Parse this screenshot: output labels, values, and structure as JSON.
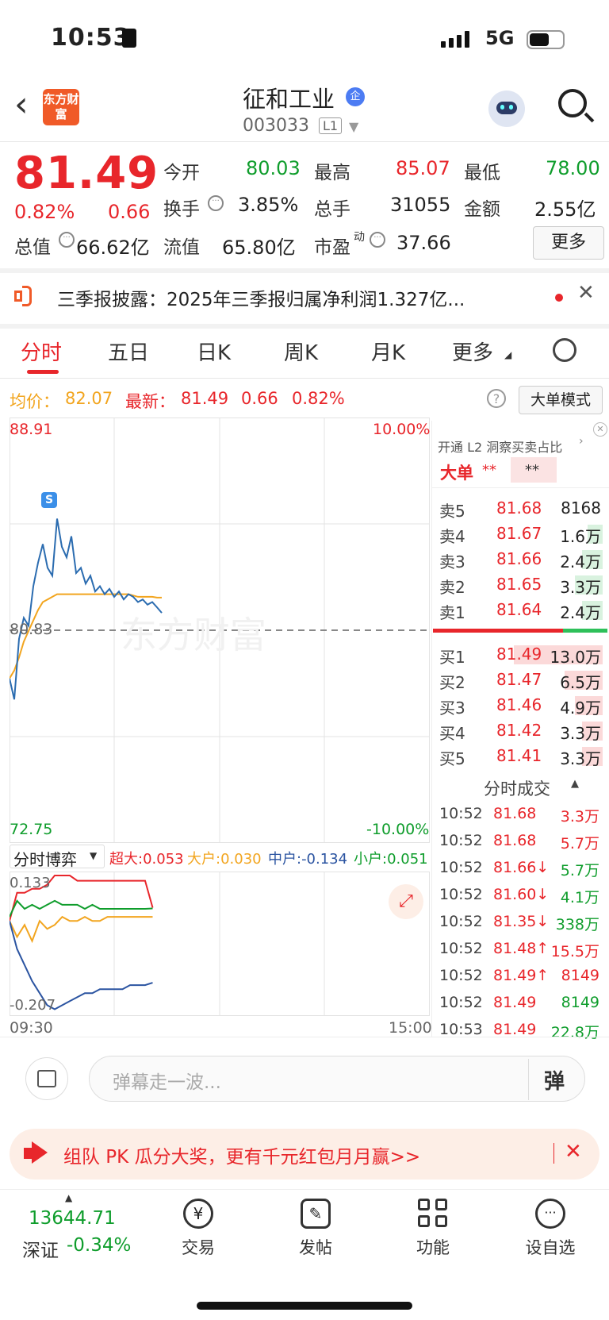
{
  "status_bar": {
    "time": "10:53",
    "network": "5G"
  },
  "header": {
    "logo_text": "东方财富",
    "stock_name": "征和工业",
    "badge": "企",
    "stock_code": "003033",
    "level": "L1"
  },
  "quote": {
    "price": "81.49",
    "change_pct": "0.82%",
    "change": "0.66",
    "open_label": "今开",
    "open": "80.03",
    "high_label": "最高",
    "high": "85.07",
    "low_label": "最低",
    "low": "78.00",
    "turnover_label": "换手",
    "turnover": "3.85%",
    "volume_label": "总手",
    "volume": "31055",
    "amount_label": "金额",
    "amount": "2.55亿",
    "mcap_label": "总值",
    "mcap": "66.62亿",
    "float_label": "流值",
    "float_mcap": "65.80亿",
    "pe_label": "市盈",
    "pe_sup": "动",
    "pe": "37.66",
    "more_label": "更多"
  },
  "announcement": {
    "text": "三季报披露：2025年三季报归属净利润1.327亿..."
  },
  "tabs": [
    "分时",
    "五日",
    "日K",
    "周K",
    "月K",
    "更多"
  ],
  "info_line": {
    "avg_label": "均价：",
    "avg": "82.07",
    "latest_label": "最新：",
    "latest": "81.49",
    "change": "0.66",
    "change_pct": "0.82%",
    "mode_btn": "大单模式"
  },
  "chart_data": {
    "type": "line",
    "y_max": "88.91",
    "y_min": "72.75",
    "y_ref": "80.83",
    "pct_max": "10.00%",
    "pct_min": "-10.00%",
    "marker": "S",
    "x_start": "09:30",
    "x_end": "15:00",
    "ylim": [
      72.75,
      88.91
    ],
    "price_series": [
      79.0,
      78.2,
      80.5,
      81.3,
      81.0,
      82.5,
      83.4,
      84.1,
      83.2,
      82.9,
      85.07,
      84.0,
      83.6,
      84.4,
      83.0,
      83.2,
      82.6,
      82.9,
      82.3,
      82.5,
      82.2,
      82.4,
      82.1,
      82.3,
      82.0,
      82.2,
      82.1,
      81.9,
      82.0,
      81.8,
      81.9,
      81.7,
      81.49
    ],
    "avg_series": [
      79.0,
      79.3,
      79.8,
      80.4,
      80.8,
      81.2,
      81.6,
      81.9,
      82.0,
      82.1,
      82.2,
      82.2,
      82.2,
      82.2,
      82.2,
      82.2,
      82.2,
      82.2,
      82.2,
      82.2,
      82.2,
      82.2,
      82.2,
      82.2,
      82.2,
      82.2,
      82.15,
      82.1,
      82.1,
      82.1,
      82.1,
      82.07,
      82.07
    ]
  },
  "sub_chart": {
    "selector": "分时博弈",
    "legend": [
      {
        "label": "超大:0.053",
        "color": "#e8262b"
      },
      {
        "label": "大户:0.030",
        "color": "#f2a51f"
      },
      {
        "label": "中户:-0.134",
        "color": "#2b54a1"
      },
      {
        "label": "小户:0.051",
        "color": "#0f9d2c"
      }
    ],
    "y_top": "0.133",
    "y_bottom": "-0.207",
    "ylim": [
      -0.207,
      0.133
    ],
    "series": {
      "super_large": [
        0.02,
        0.09,
        0.09,
        0.1,
        0.1,
        0.11,
        0.133,
        0.133,
        0.133,
        0.12,
        0.12,
        0.12,
        0.12,
        0.12,
        0.12,
        0.12,
        0.12,
        0.12,
        0.12,
        0.053
      ],
      "large": [
        0.02,
        -0.02,
        0.01,
        -0.03,
        0.02,
        0.0,
        0.01,
        0.03,
        0.02,
        0.02,
        0.03,
        0.02,
        0.02,
        0.03,
        0.03,
        0.03,
        0.03,
        0.03,
        0.03,
        0.03
      ],
      "medium": [
        0.02,
        -0.05,
        -0.09,
        -0.13,
        -0.16,
        -0.19,
        -0.2,
        -0.19,
        -0.18,
        -0.17,
        -0.16,
        -0.16,
        -0.15,
        -0.15,
        -0.15,
        -0.15,
        -0.14,
        -0.14,
        -0.14,
        -0.134
      ],
      "small": [
        0.03,
        0.07,
        0.05,
        0.06,
        0.05,
        0.06,
        0.07,
        0.06,
        0.06,
        0.06,
        0.05,
        0.06,
        0.05,
        0.05,
        0.05,
        0.05,
        0.05,
        0.05,
        0.05,
        0.051
      ]
    }
  },
  "right_panel": {
    "promo": "开通 L2 洞察买卖占比",
    "big_order_label": "大单",
    "masked1": "**",
    "masked2": "**",
    "asks": [
      {
        "label": "卖5",
        "price": "81.68",
        "vol": "8168"
      },
      {
        "label": "卖4",
        "price": "81.67",
        "vol": "1.6万"
      },
      {
        "label": "卖3",
        "price": "81.66",
        "vol": "2.4万"
      },
      {
        "label": "卖2",
        "price": "81.65",
        "vol": "3.3万"
      },
      {
        "label": "卖1",
        "price": "81.64",
        "vol": "2.4万"
      }
    ],
    "bids": [
      {
        "label": "买1",
        "price": "81.49",
        "vol": "13.0万"
      },
      {
        "label": "买2",
        "price": "81.47",
        "vol": "6.5万"
      },
      {
        "label": "买3",
        "price": "81.46",
        "vol": "4.9万"
      },
      {
        "label": "买4",
        "price": "81.42",
        "vol": "3.3万"
      },
      {
        "label": "买5",
        "price": "81.41",
        "vol": "3.3万"
      }
    ],
    "trades_title": "分时成交",
    "trades": [
      {
        "time": "10:52",
        "price": "81.68",
        "vol": "3.3万",
        "vol_color": "red"
      },
      {
        "time": "10:52",
        "price": "81.68",
        "vol": "5.7万",
        "vol_color": "red"
      },
      {
        "time": "10:52",
        "price": "81.66↓",
        "vol": "5.7万",
        "vol_color": "green"
      },
      {
        "time": "10:52",
        "price": "81.60↓",
        "vol": "4.1万",
        "vol_color": "green"
      },
      {
        "time": "10:52",
        "price": "81.35↓",
        "vol": "338万",
        "vol_color": "green"
      },
      {
        "time": "10:52",
        "price": "81.48↑",
        "vol": "15.5万",
        "vol_color": "red"
      },
      {
        "time": "10:52",
        "price": "81.49↑",
        "vol": "8149",
        "vol_color": "red"
      },
      {
        "time": "10:52",
        "price": "81.49",
        "vol": "8149",
        "vol_color": "green"
      },
      {
        "time": "10:53",
        "price": "81.49",
        "vol": "22.8万",
        "vol_color": "green"
      }
    ]
  },
  "chat": {
    "placeholder": "弹幕走一波...",
    "send_label": "弹"
  },
  "promo_banner": {
    "text": "组队 PK 瓜分大奖，更有千元红包月月赢>>"
  },
  "bottom_nav": {
    "index_value": "13644.71",
    "index_name": "深证",
    "index_change": "-0.34%",
    "items": [
      "交易",
      "发帖",
      "功能",
      "设自选"
    ]
  },
  "colors": {
    "up": "#e8262b",
    "down": "#0f9d2c",
    "avg": "#f2a51f",
    "price_line": "#2b6cb0"
  }
}
